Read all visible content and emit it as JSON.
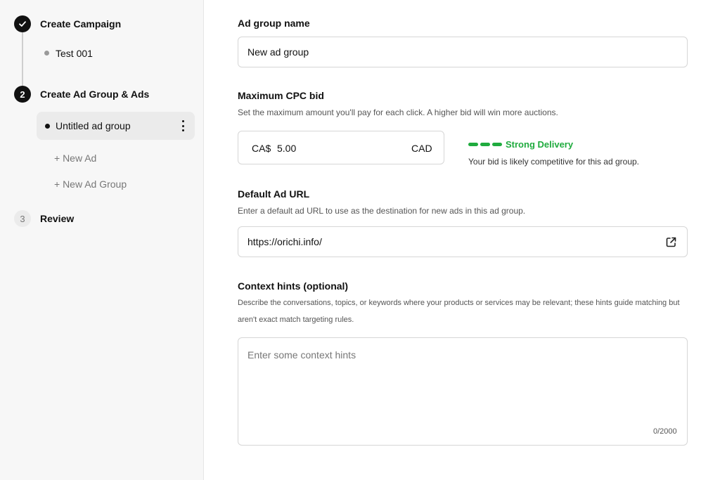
{
  "sidebar": {
    "steps": [
      {
        "number": "",
        "title": "Create Campaign",
        "state": "done",
        "icon": "check-icon"
      },
      {
        "number": "2",
        "title": "Create Ad Group & Ads",
        "state": "active"
      },
      {
        "number": "3",
        "title": "Review",
        "state": "pending"
      }
    ],
    "campaign_name": "Test 001",
    "ad_group_name": "Untitled ad group",
    "new_ad_label": "+ New Ad",
    "new_ad_group_label": "+ New Ad Group"
  },
  "form": {
    "ad_group_name": {
      "label": "Ad group name",
      "value": "New ad group"
    },
    "max_cpc": {
      "label": "Maximum CPC bid",
      "help": "Set the maximum amount you'll pay for each click. A higher bid will win more auctions.",
      "prefix": "CA$",
      "value": "5.00",
      "currency": "CAD",
      "delivery_label": "Strong Delivery",
      "delivery_desc": "Your bid is likely competitive for this ad group.",
      "delivery_color": "#1fab3e"
    },
    "default_url": {
      "label": "Default Ad URL",
      "help": "Enter a default ad URL to use as the destination for new ads in this ad group.",
      "value": "https://orichi.info/",
      "icon": "external-link-icon"
    },
    "context_hints": {
      "label": "Context hints (optional)",
      "help_line1": "Describe the conversations, topics, or keywords where your products or services may be relevant; these hints guide matching but",
      "help_line2": "aren't exact match targeting rules.",
      "placeholder": "Enter some context hints",
      "counter": "0/2000"
    }
  }
}
